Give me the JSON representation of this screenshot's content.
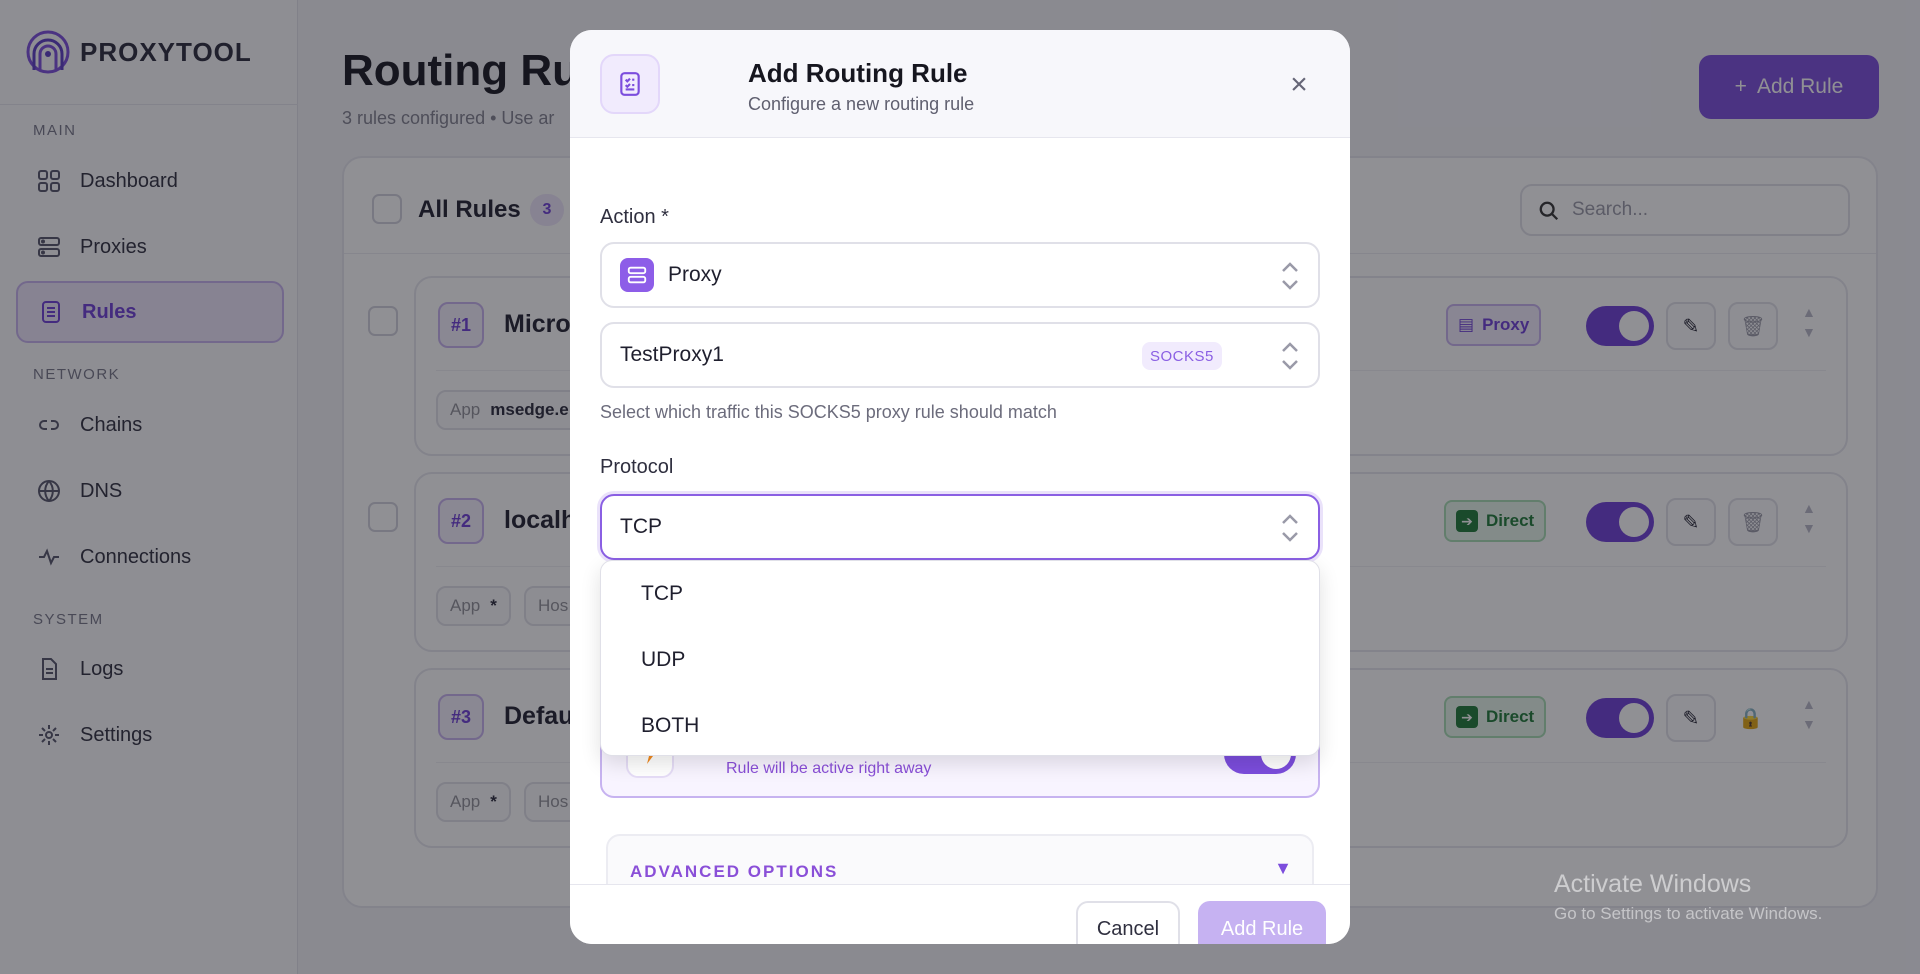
{
  "app": {
    "brand": "PROXYTOOL",
    "accent_color": "#7c4ddd"
  },
  "sidebar": {
    "sections": [
      {
        "label": "MAIN"
      },
      {
        "label": "NETWORK"
      },
      {
        "label": "SYSTEM"
      }
    ],
    "items": [
      {
        "label": "Dashboard",
        "icon": "grid-icon"
      },
      {
        "label": "Proxies",
        "icon": "server-icon"
      },
      {
        "label": "Rules",
        "icon": "checklist-icon",
        "active": true
      },
      {
        "label": "Chains",
        "icon": "link-icon"
      },
      {
        "label": "DNS",
        "icon": "globe-icon"
      },
      {
        "label": "Connections",
        "icon": "pulse-icon"
      },
      {
        "label": "Logs",
        "icon": "document-icon"
      },
      {
        "label": "Settings",
        "icon": "gear-icon"
      }
    ]
  },
  "header": {
    "title": "Routing Rule",
    "subtitle": "3 rules configured • Use ar",
    "add_button": "Add Rule"
  },
  "rules_panel": {
    "title": "All Rules",
    "count": "3",
    "search_placeholder": "Search...",
    "rules": [
      {
        "number": "#1",
        "name": "Micros",
        "action": "Proxy",
        "chip_label": "App",
        "chip_value": "msedge.e"
      },
      {
        "number": "#2",
        "name": "localh",
        "action": "Direct",
        "chip_label": "App",
        "chip_value": "*",
        "chip2": "Hos"
      },
      {
        "number": "#3",
        "name": "Defau",
        "action": "Direct",
        "chip_label": "App",
        "chip_value": "*",
        "chip2": "Hos"
      }
    ]
  },
  "modal": {
    "title": "Add Routing Rule",
    "subtitle": "Configure a new routing rule",
    "action_label": "Action *",
    "action_value": "Proxy",
    "proxy_value": "TestProxy1",
    "proxy_type": "SOCKS5",
    "proxy_help": "Select which traffic this SOCKS5 proxy rule should match",
    "protocol_label": "Protocol",
    "protocol_value": "TCP",
    "protocol_options": [
      "TCP",
      "UDP",
      "BOTH"
    ],
    "enable_sub": "Rule will be active right away",
    "advanced_label": "ADVANCED OPTIONS",
    "cancel_button": "Cancel",
    "submit_button": "Add Rule"
  },
  "watermark": {
    "line1": "Activate Windows",
    "line2": "Go to Settings to activate Windows."
  }
}
